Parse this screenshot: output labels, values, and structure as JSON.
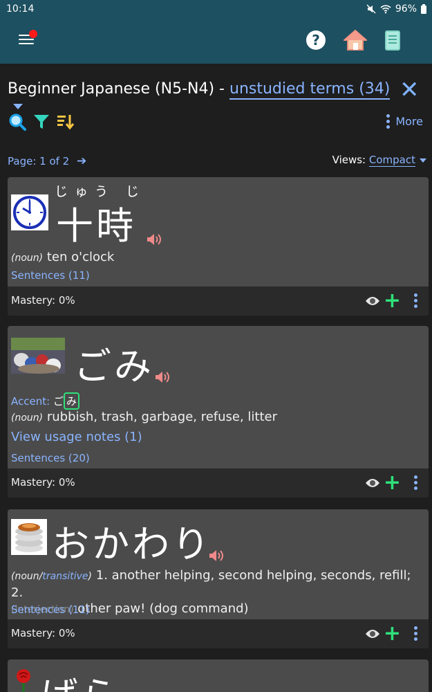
{
  "status": {
    "time": "10:14",
    "battery": "96%"
  },
  "header": {
    "deck": "Beginner Japanese (N5-N4) - ",
    "list": "unstudied terms (34)"
  },
  "toolbar": {
    "more": "More"
  },
  "pager": {
    "text": "Page: 1 of 2",
    "views_label": "Views:",
    "views_value": "Compact"
  },
  "cards": [
    {
      "word": "十時",
      "furigana": "じゅう じ",
      "pos": "(noun)",
      "definition": "ten o'clock",
      "sentences": "Sentences (11)",
      "mastery": "Mastery: 0%"
    },
    {
      "word": "ごみ",
      "accent_label": "Accent",
      "accent_kana_a": "ご",
      "accent_kana_b": "み",
      "pos": "(noun)",
      "definition": "rubbish, trash, garbage, refuse, litter",
      "usage": "View usage notes (1)",
      "sentences": "Sentences (20)",
      "mastery": "Mastery: 0%"
    },
    {
      "word": "おかわり",
      "pos_a": "(noun/",
      "pos_b": "transitive",
      "pos_c": ")",
      "definition_a": " 1. another helping, second helping, seconds, refill; 2.",
      "interj": "(interjection)",
      "definition_b": " other paw! (dog command)",
      "sentences": "Sentences (11)",
      "mastery": "Mastery: 0%"
    },
    {
      "word": "ばら"
    }
  ],
  "colors": {
    "appbar": "#1d5060",
    "accent": "#8ab4ff",
    "plus": "#2fe07a",
    "card": "#4b4b4b"
  }
}
